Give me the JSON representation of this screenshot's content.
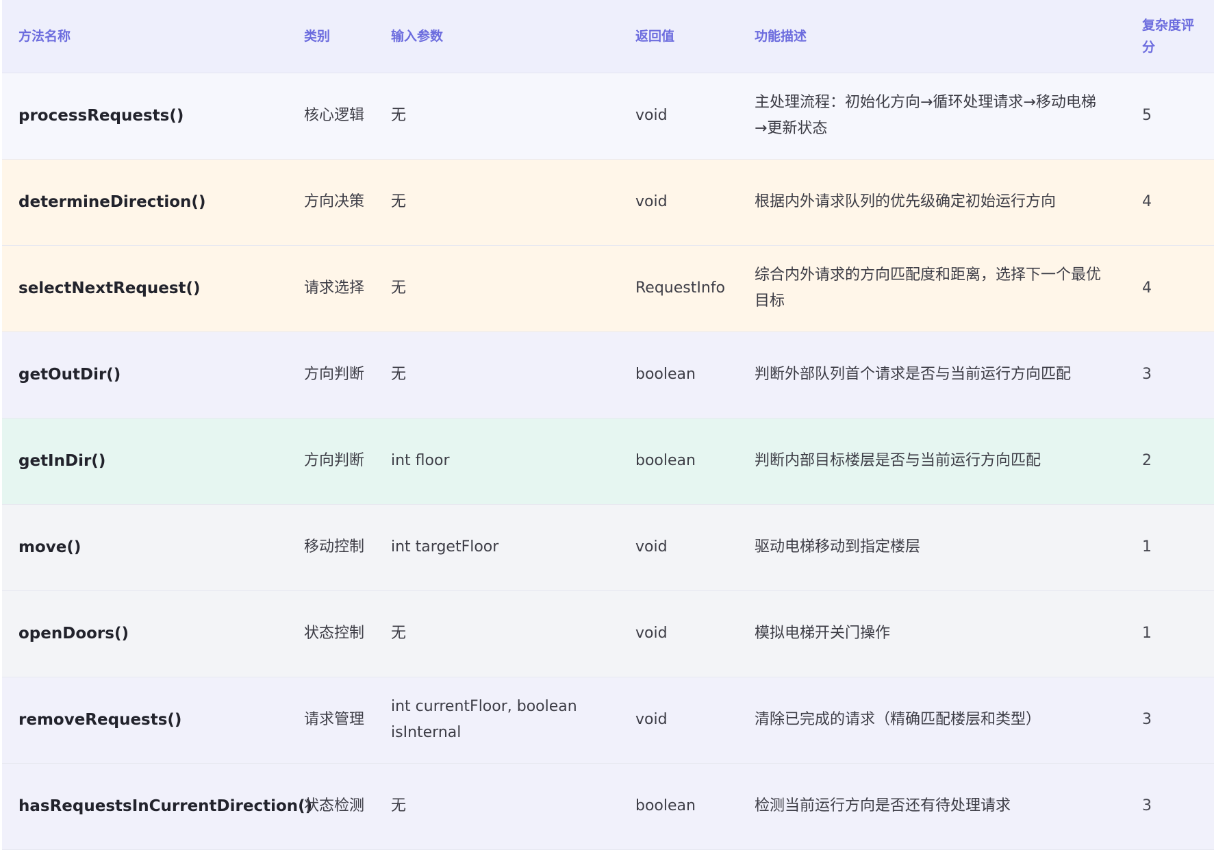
{
  "colors": {
    "header_bg": "#eeeffc",
    "header_text": "#6c6cde",
    "row_lavender": "#f1f1fb",
    "row_white": "#f6f7fd",
    "row_cream": "#fff6e9",
    "row_mint": "#e6f6f1",
    "row_gray": "#f3f4f7"
  },
  "table": {
    "headers": {
      "name": "方法名称",
      "category": "类别",
      "input": "输入参数",
      "return": "返回值",
      "description": "功能描述",
      "score": "复杂度评分"
    },
    "rows": [
      {
        "name": "processRequests()",
        "category": "核心逻辑",
        "input": "无",
        "return": "void",
        "description": "主处理流程：初始化方向→循环处理请求→移动电梯→更新状态",
        "score": "5",
        "bg": "#f6f7fd"
      },
      {
        "name": "determineDirection()",
        "category": "方向决策",
        "input": "无",
        "return": "void",
        "description": "根据内外请求队列的优先级确定初始运行方向",
        "score": "4",
        "bg": "#fff6e9"
      },
      {
        "name": "selectNextRequest()",
        "category": "请求选择",
        "input": "无",
        "return": "RequestInfo",
        "description": "综合内外请求的方向匹配度和距离，选择下一个最优目标",
        "score": "4",
        "bg": "#fff6e9"
      },
      {
        "name": "getOutDir()",
        "category": "方向判断",
        "input": "无",
        "return": "boolean",
        "description": "判断外部队列首个请求是否与当前运行方向匹配",
        "score": "3",
        "bg": "#f1f1fb"
      },
      {
        "name": "getInDir()",
        "category": "方向判断",
        "input": "int floor",
        "return": "boolean",
        "description": "判断内部目标楼层是否与当前运行方向匹配",
        "score": "2",
        "bg": "#e6f6f1"
      },
      {
        "name": "move()",
        "category": "移动控制",
        "input": "int targetFloor",
        "return": "void",
        "description": "驱动电梯移动到指定楼层",
        "score": "1",
        "bg": "#f3f4f7"
      },
      {
        "name": "openDoors()",
        "category": "状态控制",
        "input": "无",
        "return": "void",
        "description": "模拟电梯开关门操作",
        "score": "1",
        "bg": "#f3f4f7"
      },
      {
        "name": "removeRequests()",
        "category": "请求管理",
        "input": "int currentFloor, boolean isInternal",
        "return": "void",
        "description": "清除已完成的请求（精确匹配楼层和类型）",
        "score": "3",
        "bg": "#f1f1fb"
      },
      {
        "name": "hasRequestsInCurrentDirection()",
        "category": "状态检测",
        "input": "无",
        "return": "boolean",
        "description": "检测当前运行方向是否还有待处理请求",
        "score": "3",
        "bg": "#f1f1fb"
      }
    ]
  }
}
